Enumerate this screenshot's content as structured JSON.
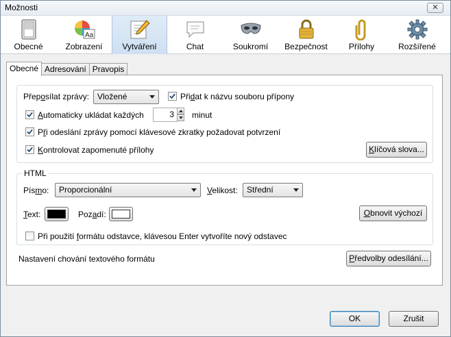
{
  "window": {
    "title": "Možnosti",
    "close_glyph": "✕"
  },
  "toolbar": {
    "items": [
      {
        "label": "Obecné",
        "icon": "general-icon"
      },
      {
        "label": "Zobrazení",
        "icon": "display-icon"
      },
      {
        "label": "Vytváření",
        "icon": "compose-icon",
        "active": true
      },
      {
        "label": "Chat",
        "icon": "chat-icon"
      },
      {
        "label": "Soukromí",
        "icon": "privacy-mask-icon"
      },
      {
        "label": "Bezpečnost",
        "icon": "lock-icon"
      },
      {
        "label": "Přílohy",
        "icon": "paperclip-icon"
      },
      {
        "label": "Rozšířené",
        "icon": "gear-icon"
      }
    ]
  },
  "tabs": [
    "Obecné",
    "Adresování",
    "Pravopis"
  ],
  "general": {
    "forward_label_pre": "Přep",
    "forward_label_u": "o",
    "forward_label_post": "sílat zprávy:",
    "forward_value": "Vložené",
    "add_ext_pre": "Při",
    "add_ext_u": "d",
    "add_ext_post": "at k názvu souboru přípony",
    "add_ext_checked": true,
    "autosave_pre": "",
    "autosave_u": "A",
    "autosave_post": "utomaticky ukládat každých",
    "autosave_checked": true,
    "autosave_value": "3",
    "autosave_unit": "minut",
    "confirm_pre": "P",
    "confirm_u": "ř",
    "confirm_post": "i odeslání zprávy pomocí klávesové zkratky požadovat potvrzení",
    "confirm_checked": true,
    "attach_pre": "",
    "attach_u": "K",
    "attach_post": "ontrolovat zapomenuté přílohy",
    "attach_checked": true,
    "keywords_pre": "",
    "keywords_u": "K",
    "keywords_post": "líčová slova..."
  },
  "html": {
    "title": "HTML",
    "font_label_pre": "Pís",
    "font_label_u": "m",
    "font_label_post": "o:",
    "font_value": "Proporcionální",
    "size_label_pre": "",
    "size_label_u": "V",
    "size_label_post": "elikost:",
    "size_value": "Střední",
    "text_label_pre": "",
    "text_label_u": "T",
    "text_label_post": "ext:",
    "text_color": "#000000",
    "bg_label_pre": "Poz",
    "bg_label_u": "a",
    "bg_label_post": "dí:",
    "bg_color": "#ffffff",
    "restore_pre": "",
    "restore_u": "O",
    "restore_post": "bnovit výchozí",
    "paragraph_pre": "Při použití ",
    "paragraph_u": "f",
    "paragraph_post": "ormátu odstavce, klávesou Enter vytvoříte nový odstavec",
    "paragraph_checked": false
  },
  "footer": {
    "text_format_label": "Nastavení chování textového formátu",
    "send_prefs_pre": "",
    "send_prefs_u": "P",
    "send_prefs_post": "ředvolby odesílání..."
  },
  "dialog": {
    "ok_label": "OK",
    "cancel_label": "Zrušit"
  }
}
